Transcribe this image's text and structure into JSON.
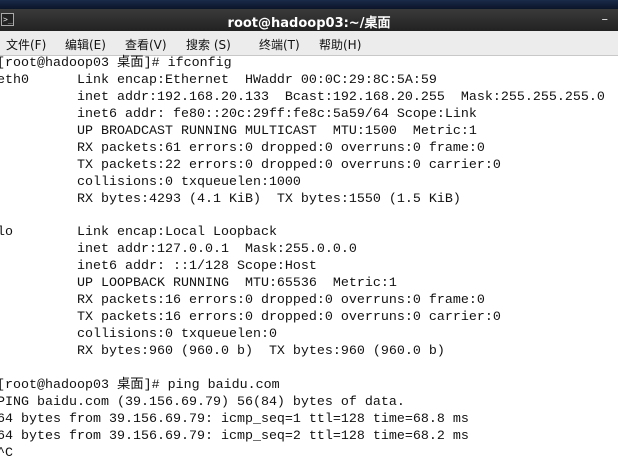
{
  "window": {
    "title": "root@hadoop03:~/桌面"
  },
  "menu": [
    "文件(F)",
    "编辑(E)",
    "查看(V)",
    "搜索 (S)",
    "终端(T)",
    "帮助(H)"
  ],
  "terminal_lines": [
    "[root@hadoop03 桌面]# ifconfig",
    "eth0      Link encap:Ethernet  HWaddr 00:0C:29:8C:5A:59",
    "          inet addr:192.168.20.133  Bcast:192.168.20.255  Mask:255.255.255.0",
    "          inet6 addr: fe80::20c:29ff:fe8c:5a59/64 Scope:Link",
    "          UP BROADCAST RUNNING MULTICAST  MTU:1500  Metric:1",
    "          RX packets:61 errors:0 dropped:0 overruns:0 frame:0",
    "          TX packets:22 errors:0 dropped:0 overruns:0 carrier:0",
    "          collisions:0 txqueuelen:1000",
    "          RX bytes:4293 (4.1 KiB)  TX bytes:1550 (1.5 KiB)",
    "",
    "lo        Link encap:Local Loopback",
    "          inet addr:127.0.0.1  Mask:255.0.0.0",
    "          inet6 addr: ::1/128 Scope:Host",
    "          UP LOOPBACK RUNNING  MTU:65536  Metric:1",
    "          RX packets:16 errors:0 dropped:0 overruns:0 frame:0",
    "          TX packets:16 errors:0 dropped:0 overruns:0 carrier:0",
    "          collisions:0 txqueuelen:0",
    "          RX bytes:960 (960.0 b)  TX bytes:960 (960.0 b)",
    "",
    "[root@hadoop03 桌面]# ping baidu.com",
    "PING baidu.com (39.156.69.79) 56(84) bytes of data.",
    "64 bytes from 39.156.69.79: icmp_seq=1 ttl=128 time=68.8 ms",
    "64 bytes from 39.156.69.79: icmp_seq=2 ttl=128 time=68.2 ms",
    "^C"
  ]
}
